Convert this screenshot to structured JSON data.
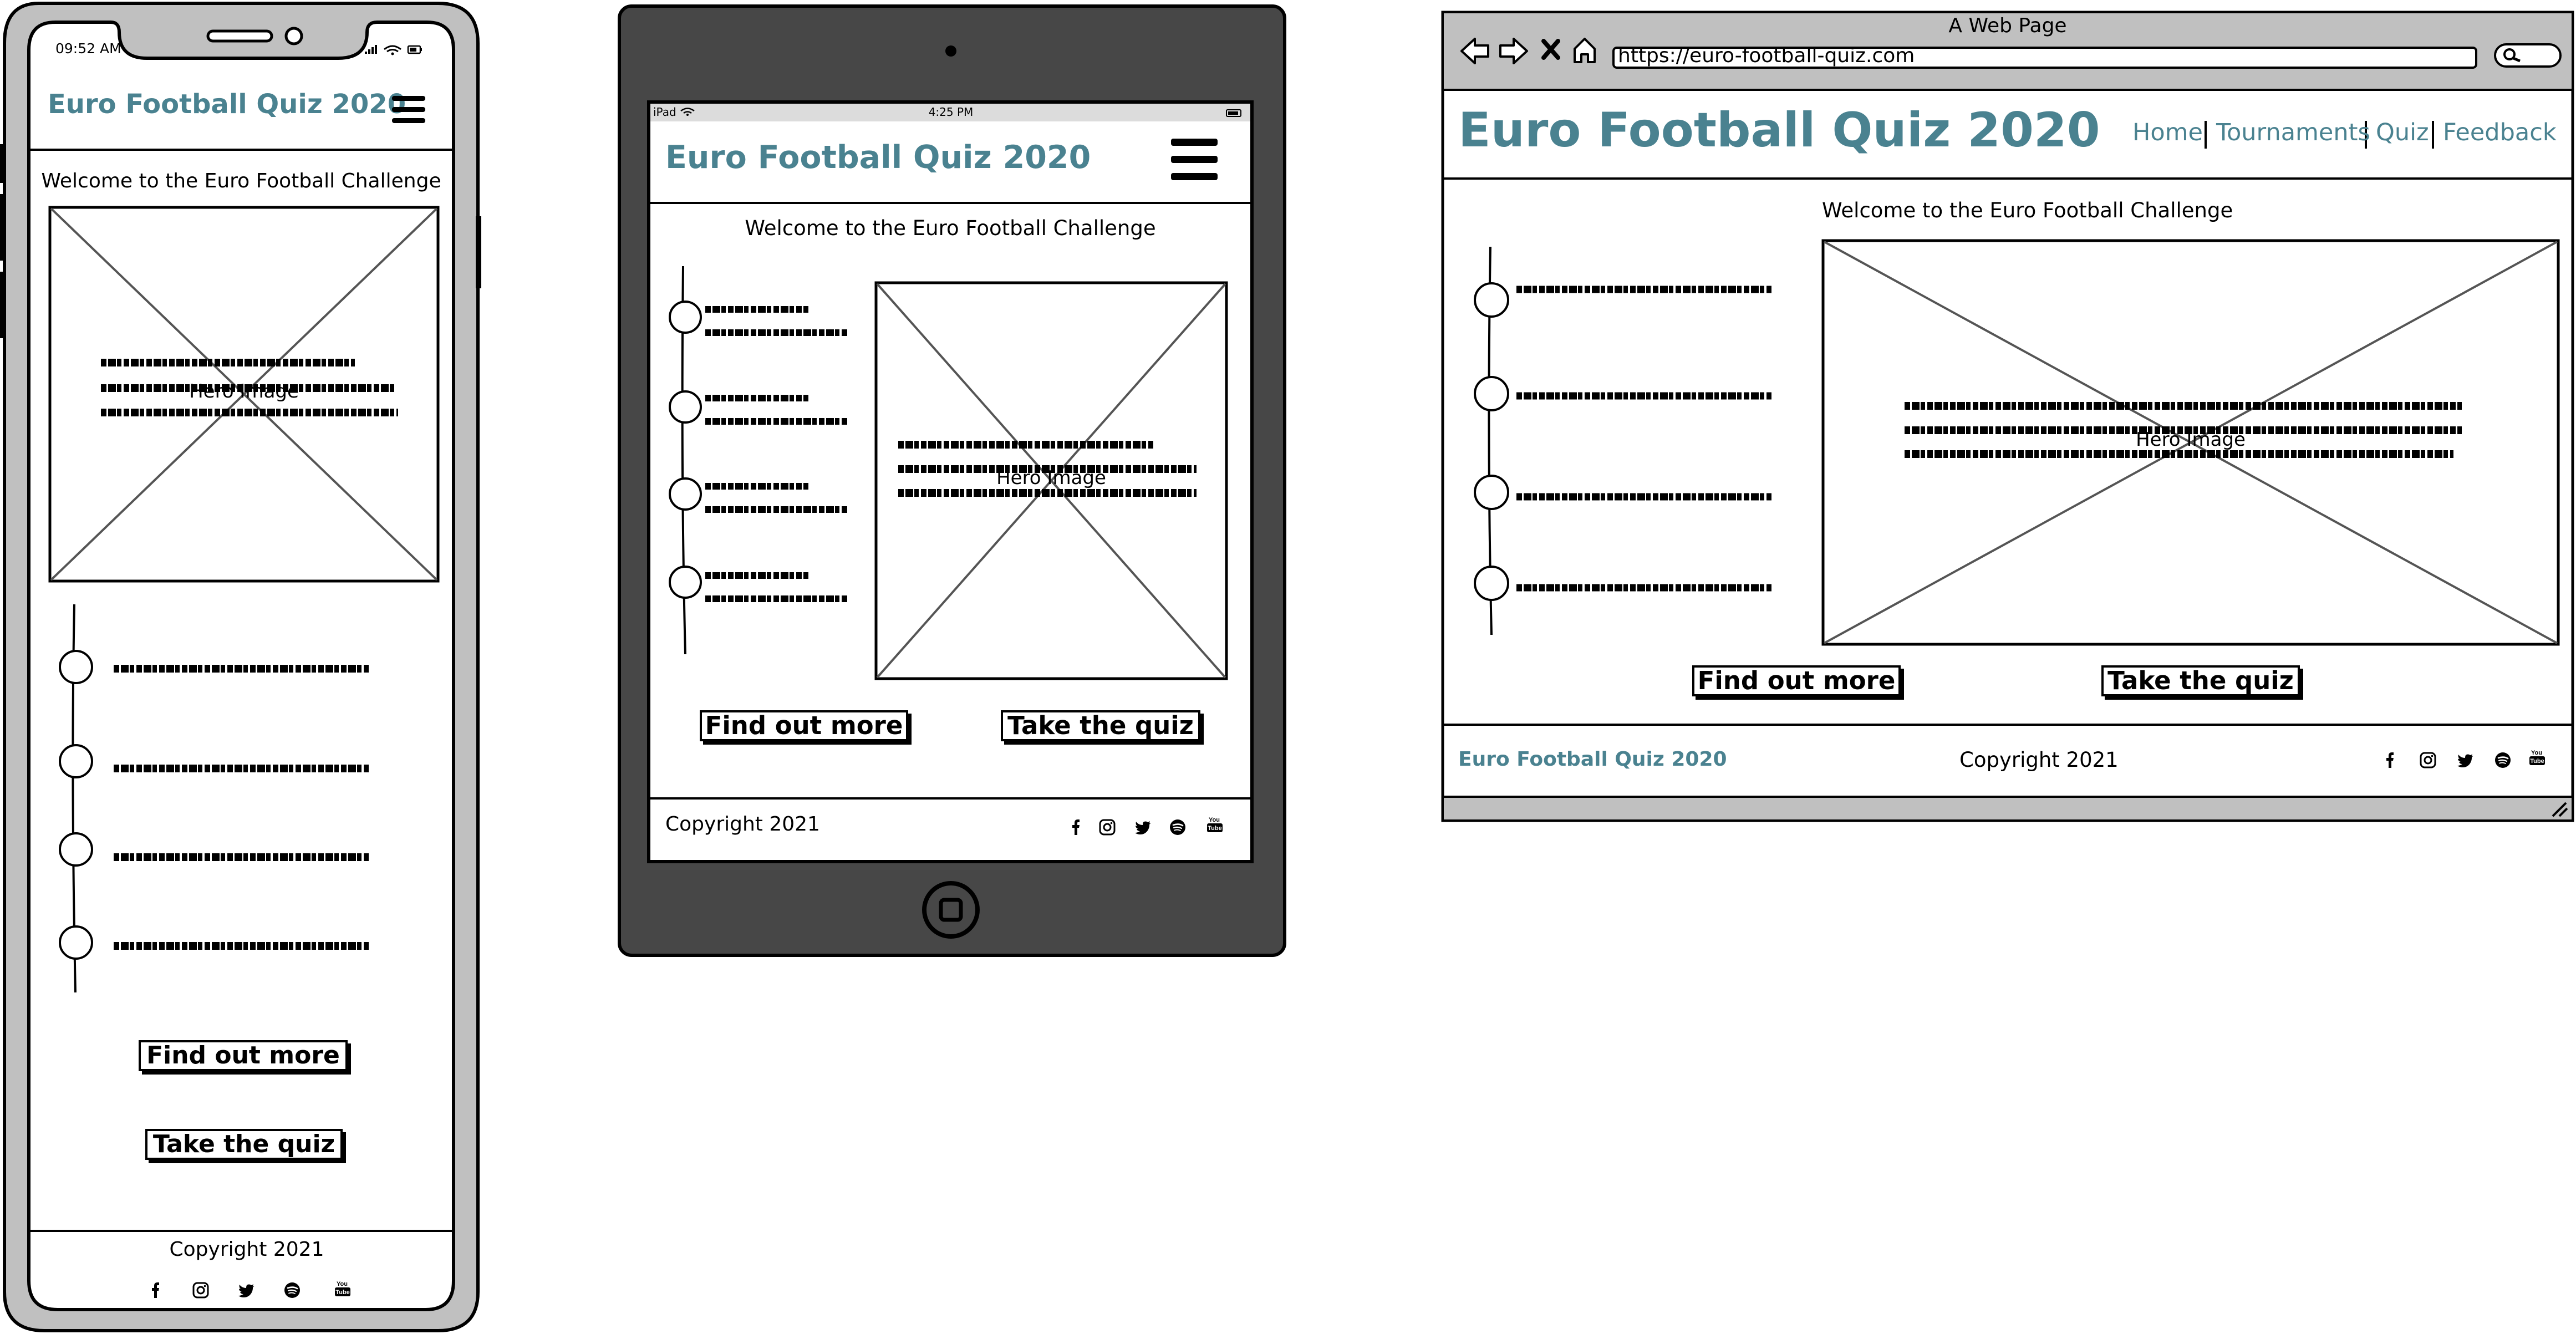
{
  "brand": "Euro Football Quiz 2020",
  "welcome": "Welcome to the Euro Football Challenge",
  "hero_label": "Hero Image",
  "buttons": {
    "find_out_more": "Find out more",
    "take_quiz": "Take the quiz"
  },
  "copyright": "Copyright 2021",
  "social_icons": [
    "facebook-icon",
    "instagram-icon",
    "twitter-icon",
    "spotify-icon",
    "youtube-icon"
  ],
  "phone": {
    "status_time": "09:52 AM"
  },
  "tablet": {
    "status_left": "iPad",
    "status_time": "4:25 PM"
  },
  "browser": {
    "window_title": "A Web Page",
    "url": "https://euro-football-quiz.com",
    "nav": [
      "Home",
      "Tournaments",
      "Quiz",
      "Feedback"
    ]
  },
  "colors": {
    "brand": "#4a8290",
    "device_frame": "#c0c0c0",
    "tablet_body": "#474747",
    "browser_chrome": "#c0c0c0"
  }
}
